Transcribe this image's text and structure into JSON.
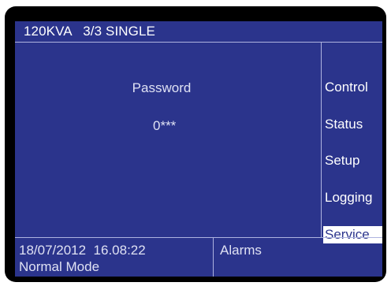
{
  "header": {
    "title": "120KVA   3/3 SINGLE"
  },
  "password": {
    "label": "Password",
    "value": "0***"
  },
  "menu": {
    "items": [
      {
        "label": "Control",
        "active": false
      },
      {
        "label": "Status",
        "active": false
      },
      {
        "label": "Setup",
        "active": false
      },
      {
        "label": "Logging",
        "active": false
      },
      {
        "label": "Service",
        "active": true
      }
    ]
  },
  "footer": {
    "datetime": "18/07/2012  16.08:22",
    "mode": "Normal Mode",
    "alarms": "Alarms"
  },
  "colors": {
    "screen_background": "#2b348c",
    "text": "#ffffff",
    "bezel": "#000000"
  }
}
